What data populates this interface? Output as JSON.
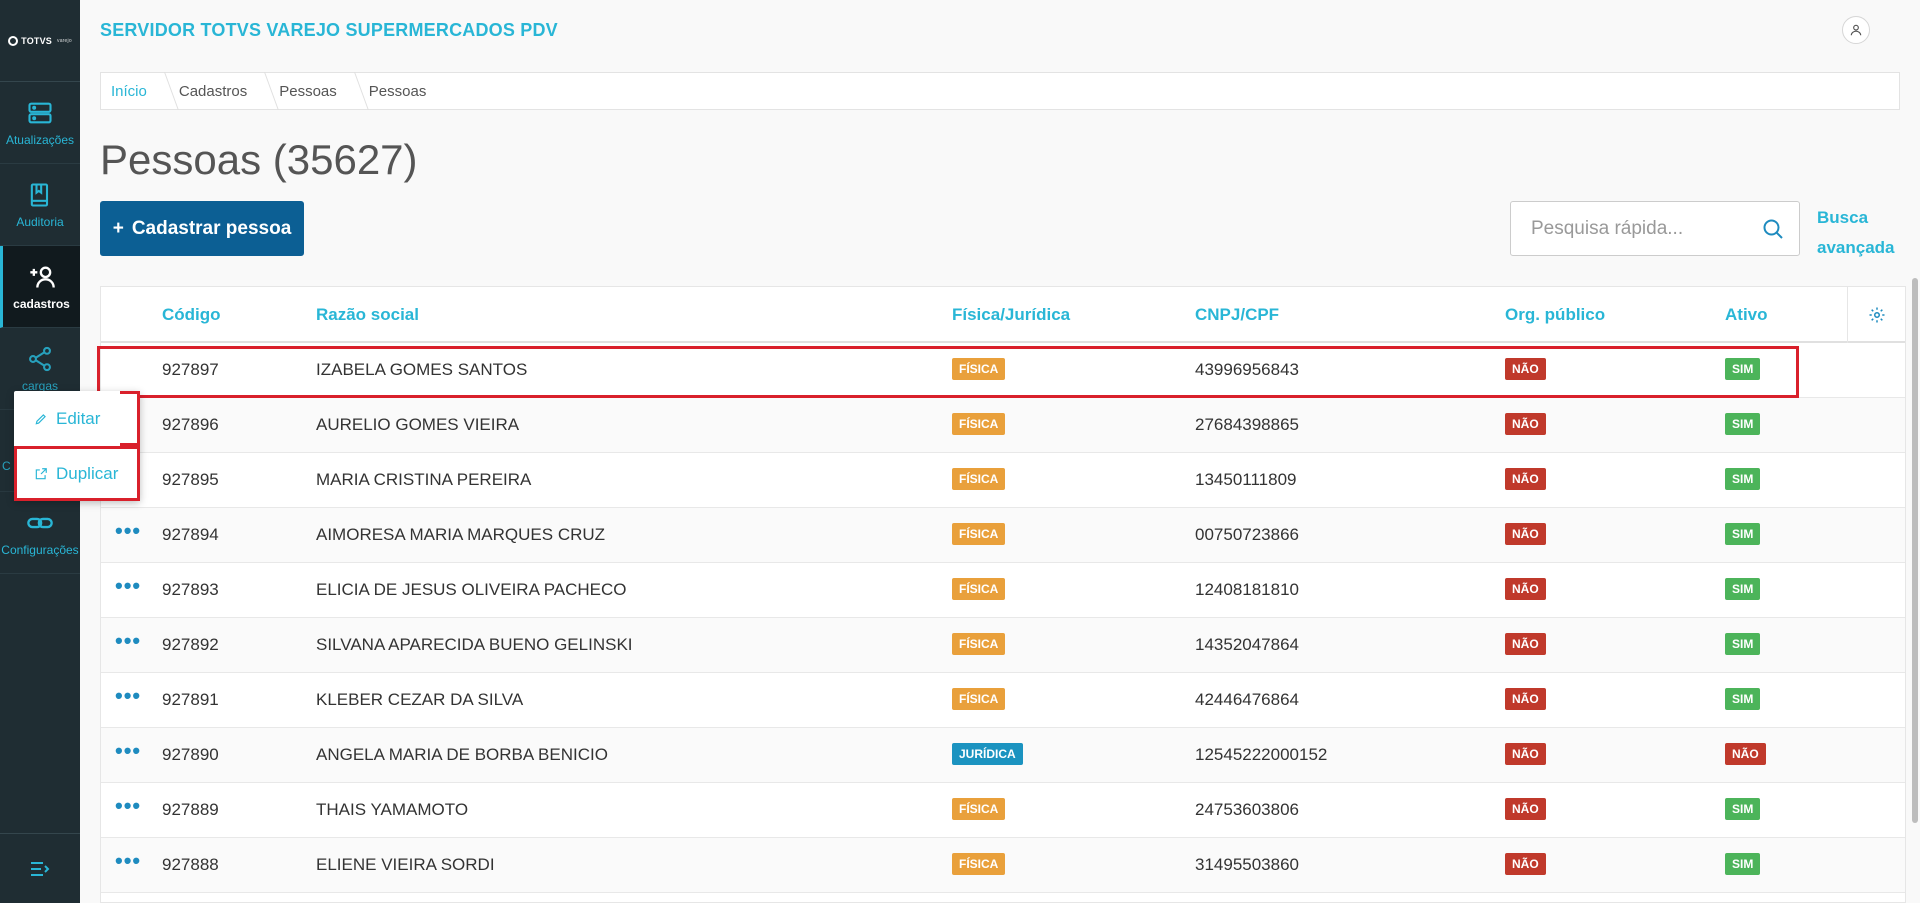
{
  "app": {
    "title": "SERVIDOR TOTVS VAREJO SUPERMERCADOS PDV",
    "logo_text": "TOTVS",
    "logo_sub": "varejo"
  },
  "sidebar": {
    "items": [
      {
        "label": "Atualizações",
        "icon": "server-icon"
      },
      {
        "label": "Auditoria",
        "icon": "book-icon"
      },
      {
        "label": "cadastros",
        "icon": "add-user-icon",
        "active": true
      },
      {
        "label": "cargas",
        "icon": "share-icon"
      },
      {
        "label": "C",
        "icon": "hidden-icon"
      },
      {
        "label": "Configurações",
        "icon": "link-icon"
      }
    ]
  },
  "breadcrumb": [
    "Início",
    "Cadastros",
    "Pessoas",
    "Pessoas"
  ],
  "page": {
    "title": "Pessoas (35627)",
    "add_button": "Cadastrar pessoa",
    "add_icon": "+",
    "search_placeholder": "Pesquisa rápida...",
    "advanced_search_line1": "Busca",
    "advanced_search_line2": "avançada"
  },
  "table": {
    "headers": [
      "Código",
      "Razão social",
      "Física/Jurídica",
      "CNPJ/CPF",
      "Org. público",
      "Ativo"
    ],
    "rows": [
      {
        "codigo": "927897",
        "razao": "IZABELA GOMES SANTOS",
        "tipo": "FÍSICA",
        "doc": "43996956843",
        "org": "NÃO",
        "ativo": "SIM"
      },
      {
        "codigo": "927896",
        "razao": "AURELIO GOMES VIEIRA",
        "tipo": "FÍSICA",
        "doc": "27684398865",
        "org": "NÃO",
        "ativo": "SIM"
      },
      {
        "codigo": "927895",
        "razao": "MARIA CRISTINA PEREIRA",
        "tipo": "FÍSICA",
        "doc": "13450111809",
        "org": "NÃO",
        "ativo": "SIM"
      },
      {
        "codigo": "927894",
        "razao": "AIMORESA MARIA MARQUES CRUZ",
        "tipo": "FÍSICA",
        "doc": "00750723866",
        "org": "NÃO",
        "ativo": "SIM"
      },
      {
        "codigo": "927893",
        "razao": "ELICIA DE JESUS OLIVEIRA PACHECO",
        "tipo": "FÍSICA",
        "doc": "12408181810",
        "org": "NÃO",
        "ativo": "SIM"
      },
      {
        "codigo": "927892",
        "razao": "SILVANA APARECIDA BUENO GELINSKI",
        "tipo": "FÍSICA",
        "doc": "14352047864",
        "org": "NÃO",
        "ativo": "SIM"
      },
      {
        "codigo": "927891",
        "razao": "KLEBER CEZAR DA SILVA",
        "tipo": "FÍSICA",
        "doc": "42446476864",
        "org": "NÃO",
        "ativo": "SIM"
      },
      {
        "codigo": "927890",
        "razao": "ANGELA MARIA DE BORBA BENICIO",
        "tipo": "JURÍDICA",
        "doc": "12545222000152",
        "org": "NÃO",
        "ativo": "NÃO"
      },
      {
        "codigo": "927889",
        "razao": "THAIS YAMAMOTO",
        "tipo": "FÍSICA",
        "doc": "24753603806",
        "org": "NÃO",
        "ativo": "SIM"
      },
      {
        "codigo": "927888",
        "razao": "ELIENE VIEIRA SORDI",
        "tipo": "FÍSICA",
        "doc": "31495503860",
        "org": "NÃO",
        "ativo": "SIM"
      }
    ]
  },
  "context_menu": {
    "items": [
      {
        "label": "Editar",
        "icon": "pencil-icon"
      },
      {
        "label": "Duplicar",
        "icon": "external-link-icon"
      }
    ]
  },
  "colors": {
    "accent": "#29b6d6",
    "primary_button": "#0c5f94",
    "sidebar_bg": "#1f2d33",
    "badge_fisica": "#e9a03b",
    "badge_juridica": "#1b93c0",
    "badge_nao": "#c0392b",
    "badge_sim": "#4cb45a",
    "highlight": "#d9202b"
  }
}
